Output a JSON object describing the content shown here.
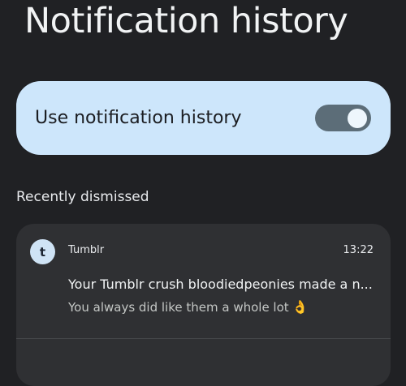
{
  "page": {
    "title": "Notification history"
  },
  "toggle": {
    "label": "Use notification history",
    "enabled": true
  },
  "section": {
    "label": "Recently dismissed"
  },
  "notifications": [
    {
      "app_icon_letter": "t",
      "app_icon": "tumblr-icon",
      "app_name": "Tumblr",
      "time": "13:22",
      "title": "Your Tumblr crush bloodiedpeonies made a n...",
      "text": "You always did like them a whole lot",
      "emoji": "👌"
    }
  ],
  "colors": {
    "background": "#202124",
    "toggle_card": "#cde6fb",
    "switch_track": "#5c6d78",
    "card": "#2f3033"
  }
}
